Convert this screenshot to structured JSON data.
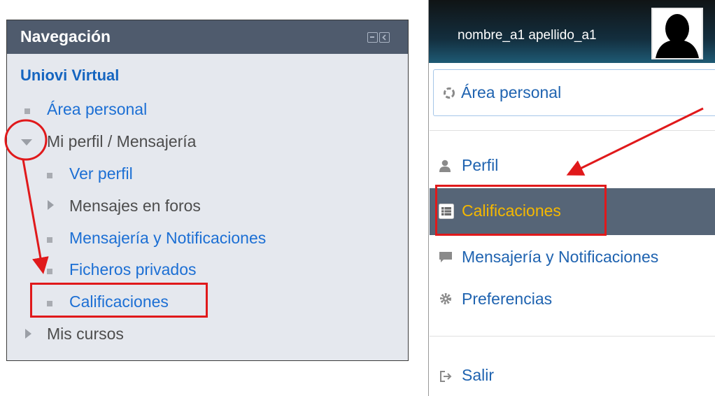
{
  "navigation": {
    "title": "Navegación",
    "root": "Uniovi Virtual",
    "area_personal": "Área personal",
    "mi_perfil": "Mi perfil / Mensajería",
    "ver_perfil": "Ver perfil",
    "mensajes_foros": "Mensajes en foros",
    "mensajeria": "Mensajería y Notificaciones",
    "ficheros": "Ficheros privados",
    "calificaciones": "Calificaciones",
    "mis_cursos": "Mis cursos"
  },
  "user_menu": {
    "user_name": "nombre_a1 apellido_a1",
    "area_personal": "Área personal",
    "perfil": "Perfil",
    "calificaciones": "Calificaciones",
    "mensajeria": "Mensajería y Notificaciones",
    "preferencias": "Preferencias",
    "salir": "Salir"
  },
  "colors": {
    "link": "#1c6fd4",
    "header": "#4f5b6d",
    "highlight_bg": "#566577",
    "highlight_text": "#f5b800",
    "annotation": "#e0191b"
  }
}
